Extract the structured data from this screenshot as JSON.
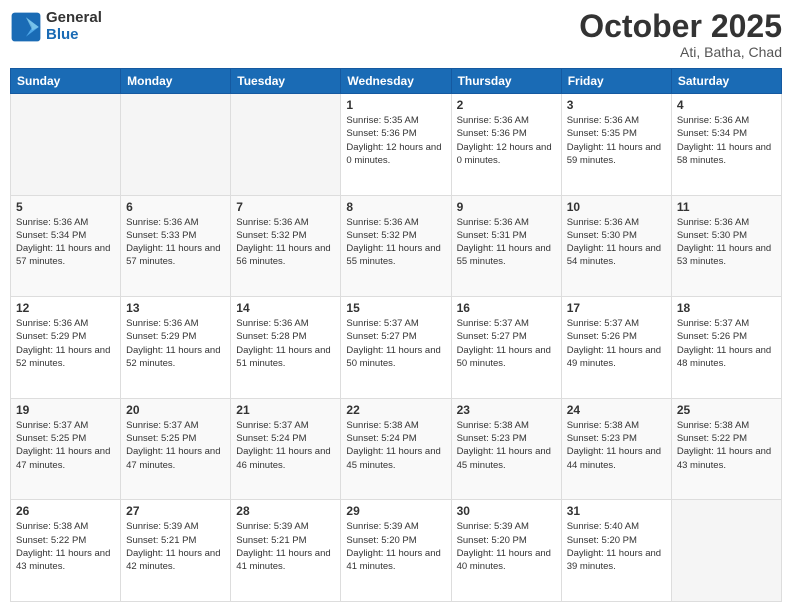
{
  "header": {
    "logo_general": "General",
    "logo_blue": "Blue",
    "month": "October 2025",
    "location": "Ati, Batha, Chad"
  },
  "days_of_week": [
    "Sunday",
    "Monday",
    "Tuesday",
    "Wednesday",
    "Thursday",
    "Friday",
    "Saturday"
  ],
  "weeks": [
    [
      {
        "day": "",
        "sunrise": "",
        "sunset": "",
        "daylight": ""
      },
      {
        "day": "",
        "sunrise": "",
        "sunset": "",
        "daylight": ""
      },
      {
        "day": "",
        "sunrise": "",
        "sunset": "",
        "daylight": ""
      },
      {
        "day": "1",
        "sunrise": "Sunrise: 5:35 AM",
        "sunset": "Sunset: 5:36 PM",
        "daylight": "Daylight: 12 hours and 0 minutes."
      },
      {
        "day": "2",
        "sunrise": "Sunrise: 5:36 AM",
        "sunset": "Sunset: 5:36 PM",
        "daylight": "Daylight: 12 hours and 0 minutes."
      },
      {
        "day": "3",
        "sunrise": "Sunrise: 5:36 AM",
        "sunset": "Sunset: 5:35 PM",
        "daylight": "Daylight: 11 hours and 59 minutes."
      },
      {
        "day": "4",
        "sunrise": "Sunrise: 5:36 AM",
        "sunset": "Sunset: 5:34 PM",
        "daylight": "Daylight: 11 hours and 58 minutes."
      }
    ],
    [
      {
        "day": "5",
        "sunrise": "Sunrise: 5:36 AM",
        "sunset": "Sunset: 5:34 PM",
        "daylight": "Daylight: 11 hours and 57 minutes."
      },
      {
        "day": "6",
        "sunrise": "Sunrise: 5:36 AM",
        "sunset": "Sunset: 5:33 PM",
        "daylight": "Daylight: 11 hours and 57 minutes."
      },
      {
        "day": "7",
        "sunrise": "Sunrise: 5:36 AM",
        "sunset": "Sunset: 5:32 PM",
        "daylight": "Daylight: 11 hours and 56 minutes."
      },
      {
        "day": "8",
        "sunrise": "Sunrise: 5:36 AM",
        "sunset": "Sunset: 5:32 PM",
        "daylight": "Daylight: 11 hours and 55 minutes."
      },
      {
        "day": "9",
        "sunrise": "Sunrise: 5:36 AM",
        "sunset": "Sunset: 5:31 PM",
        "daylight": "Daylight: 11 hours and 55 minutes."
      },
      {
        "day": "10",
        "sunrise": "Sunrise: 5:36 AM",
        "sunset": "Sunset: 5:30 PM",
        "daylight": "Daylight: 11 hours and 54 minutes."
      },
      {
        "day": "11",
        "sunrise": "Sunrise: 5:36 AM",
        "sunset": "Sunset: 5:30 PM",
        "daylight": "Daylight: 11 hours and 53 minutes."
      }
    ],
    [
      {
        "day": "12",
        "sunrise": "Sunrise: 5:36 AM",
        "sunset": "Sunset: 5:29 PM",
        "daylight": "Daylight: 11 hours and 52 minutes."
      },
      {
        "day": "13",
        "sunrise": "Sunrise: 5:36 AM",
        "sunset": "Sunset: 5:29 PM",
        "daylight": "Daylight: 11 hours and 52 minutes."
      },
      {
        "day": "14",
        "sunrise": "Sunrise: 5:36 AM",
        "sunset": "Sunset: 5:28 PM",
        "daylight": "Daylight: 11 hours and 51 minutes."
      },
      {
        "day": "15",
        "sunrise": "Sunrise: 5:37 AM",
        "sunset": "Sunset: 5:27 PM",
        "daylight": "Daylight: 11 hours and 50 minutes."
      },
      {
        "day": "16",
        "sunrise": "Sunrise: 5:37 AM",
        "sunset": "Sunset: 5:27 PM",
        "daylight": "Daylight: 11 hours and 50 minutes."
      },
      {
        "day": "17",
        "sunrise": "Sunrise: 5:37 AM",
        "sunset": "Sunset: 5:26 PM",
        "daylight": "Daylight: 11 hours and 49 minutes."
      },
      {
        "day": "18",
        "sunrise": "Sunrise: 5:37 AM",
        "sunset": "Sunset: 5:26 PM",
        "daylight": "Daylight: 11 hours and 48 minutes."
      }
    ],
    [
      {
        "day": "19",
        "sunrise": "Sunrise: 5:37 AM",
        "sunset": "Sunset: 5:25 PM",
        "daylight": "Daylight: 11 hours and 47 minutes."
      },
      {
        "day": "20",
        "sunrise": "Sunrise: 5:37 AM",
        "sunset": "Sunset: 5:25 PM",
        "daylight": "Daylight: 11 hours and 47 minutes."
      },
      {
        "day": "21",
        "sunrise": "Sunrise: 5:37 AM",
        "sunset": "Sunset: 5:24 PM",
        "daylight": "Daylight: 11 hours and 46 minutes."
      },
      {
        "day": "22",
        "sunrise": "Sunrise: 5:38 AM",
        "sunset": "Sunset: 5:24 PM",
        "daylight": "Daylight: 11 hours and 45 minutes."
      },
      {
        "day": "23",
        "sunrise": "Sunrise: 5:38 AM",
        "sunset": "Sunset: 5:23 PM",
        "daylight": "Daylight: 11 hours and 45 minutes."
      },
      {
        "day": "24",
        "sunrise": "Sunrise: 5:38 AM",
        "sunset": "Sunset: 5:23 PM",
        "daylight": "Daylight: 11 hours and 44 minutes."
      },
      {
        "day": "25",
        "sunrise": "Sunrise: 5:38 AM",
        "sunset": "Sunset: 5:22 PM",
        "daylight": "Daylight: 11 hours and 43 minutes."
      }
    ],
    [
      {
        "day": "26",
        "sunrise": "Sunrise: 5:38 AM",
        "sunset": "Sunset: 5:22 PM",
        "daylight": "Daylight: 11 hours and 43 minutes."
      },
      {
        "day": "27",
        "sunrise": "Sunrise: 5:39 AM",
        "sunset": "Sunset: 5:21 PM",
        "daylight": "Daylight: 11 hours and 42 minutes."
      },
      {
        "day": "28",
        "sunrise": "Sunrise: 5:39 AM",
        "sunset": "Sunset: 5:21 PM",
        "daylight": "Daylight: 11 hours and 41 minutes."
      },
      {
        "day": "29",
        "sunrise": "Sunrise: 5:39 AM",
        "sunset": "Sunset: 5:20 PM",
        "daylight": "Daylight: 11 hours and 41 minutes."
      },
      {
        "day": "30",
        "sunrise": "Sunrise: 5:39 AM",
        "sunset": "Sunset: 5:20 PM",
        "daylight": "Daylight: 11 hours and 40 minutes."
      },
      {
        "day": "31",
        "sunrise": "Sunrise: 5:40 AM",
        "sunset": "Sunset: 5:20 PM",
        "daylight": "Daylight: 11 hours and 39 minutes."
      },
      {
        "day": "",
        "sunrise": "",
        "sunset": "",
        "daylight": ""
      }
    ]
  ]
}
